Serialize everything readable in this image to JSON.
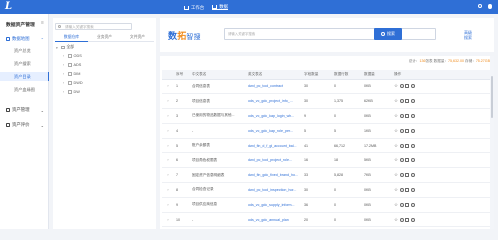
{
  "topbar": {
    "logo": "L",
    "nav": [
      {
        "label": "工作台",
        "icon": "home-icon",
        "active": false
      },
      {
        "label": "数据",
        "icon": "grid-icon",
        "active": true
      }
    ],
    "accent": "#2f6fd6"
  },
  "sidebar": {
    "title": "数据资产管理",
    "collapse_icon": "collapse-icon",
    "groups": [
      {
        "label": "数据地图",
        "icon": "map-icon",
        "active": true,
        "items": [
          {
            "label": "资产总览",
            "active": false
          },
          {
            "label": "资产搜索",
            "active": false
          },
          {
            "label": "资产目录",
            "active": true
          },
          {
            "label": "资产血缘图",
            "active": false
          }
        ]
      },
      {
        "label": "资产管理",
        "icon": "folder-icon",
        "active": false,
        "items": []
      },
      {
        "label": "资产评价",
        "icon": "chart-icon",
        "active": false,
        "items": []
      }
    ]
  },
  "tree": {
    "search_placeholder": "请输入关键字搜索",
    "tabs": [
      "数据仓库",
      "业务资产",
      "文件资产"
    ],
    "active_tab": 0,
    "root": "全部",
    "nodes": [
      "ODS",
      "ADS",
      "DIM",
      "DWD",
      "DW"
    ]
  },
  "search": {
    "brand_a": "数",
    "brand_b": "拓",
    "brand_c": "智搜",
    "placeholder": "请输入关键字搜索",
    "button_label": "搜索",
    "advanced_label": "高级",
    "advanced_sub": "搜索"
  },
  "table": {
    "stats_prefix": "总计：",
    "stats_count": "136",
    "stats_unit": "张表",
    "stats_rows_label": "   数据量：",
    "stats_rows": "75,632.00",
    "stats_size_label": "   存储：",
    "stats_size": "75.27GB",
    "columns": [
      "",
      "序号",
      "中文表名",
      "英文表名",
      "字段数量",
      "数据行数",
      "数据量",
      "操作"
    ],
    "rows": [
      {
        "no": "1",
        "cn": "合同信息表",
        "en": "dwd_pc_tool_contract",
        "fields": "30",
        "rows": "0",
        "size": "0KB"
      },
      {
        "no": "2",
        "cn": "项目信息表",
        "en": "ods_vc_gdc_project_info_...",
        "fields": "30",
        "rows": "1,375",
        "size": "62KB"
      },
      {
        "no": "3",
        "cn": "已使用的物品数据与其他...",
        "en": "ods_vc_gdc_kap_login_wh...",
        "fields": "9",
        "rows": "0",
        "size": "0KB"
      },
      {
        "no": "4",
        "cn": "-",
        "en": "ods_vc_gdc_kap_role_per...",
        "fields": "5",
        "rows": "5",
        "size": "1KB"
      },
      {
        "no": "5",
        "cn": "账户余额表",
        "en": "dwd_fin_d_f_gl_account_bal...",
        "fields": "41",
        "rows": "66,712",
        "size": "17.2MB"
      },
      {
        "no": "6",
        "cn": "项目角色权限表",
        "en": "dwd_pc_tool_project_role...",
        "fields": "16",
        "rows": "18",
        "size": "5KB"
      },
      {
        "no": "7",
        "cn": "固定资产信息明细表",
        "en": "dwd_fin_gdc_fixed_brand_ho...",
        "fields": "33",
        "rows": "5,828",
        "size": "7KB"
      },
      {
        "no": "8",
        "cn": "合同检查记录",
        "en": "dwd_pc_tool_inspection_hor...",
        "fields": "30",
        "rows": "0",
        "size": "0KB"
      },
      {
        "no": "9",
        "cn": "项目供应商信息",
        "en": "ods_vc_gdc_supply_inform...",
        "fields": "36",
        "rows": "0",
        "size": "0KB"
      },
      {
        "no": "10",
        "cn": "-",
        "en": "ods_vc_gdc_annual_plan",
        "fields": "20",
        "rows": "0",
        "size": "0KB"
      }
    ],
    "row_expand_icon": "chevron-right-icon",
    "op_icons": [
      "star-icon",
      "eye-icon",
      "copy-icon",
      "more-icon"
    ]
  }
}
